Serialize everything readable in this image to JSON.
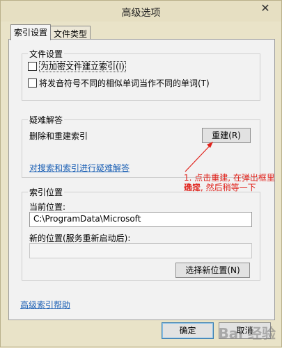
{
  "window": {
    "title": "高级选项",
    "close_glyph": "✕"
  },
  "tabs": [
    {
      "label": "索引设置",
      "active": true
    },
    {
      "label": "文件类型",
      "active": false
    }
  ],
  "file_settings": {
    "group_label": "文件设置",
    "encrypt_label": "为加密文件建立索引(I)",
    "encrypt_checked": false,
    "diacritics_label": "将发音符号不同的相似单词当作不同的单词(T)",
    "diacritics_checked": false
  },
  "troubleshooting": {
    "group_label": "疑难解答",
    "rebuild_text": "删除和重建索引",
    "rebuild_button": "重建(R)",
    "troubleshoot_link": "对搜索和索引进行疑难解答"
  },
  "index_location": {
    "group_label": "索引位置",
    "current_label": "当前位置:",
    "current_value": "C:\\ProgramData\\Microsoft",
    "new_label": "新的位置(服务重新启动后):",
    "new_value": "",
    "select_button": "选择新位置(N)"
  },
  "help_link": "高级索引帮助",
  "footer": {
    "ok_button": "确定",
    "cancel_button": "取消"
  },
  "annotation": {
    "line1": "1. 点击重建, 在弹出框里选择",
    "line2": "确定, 然后稍等一下",
    "color": "#e0221b"
  },
  "watermark": "Bai 经验"
}
